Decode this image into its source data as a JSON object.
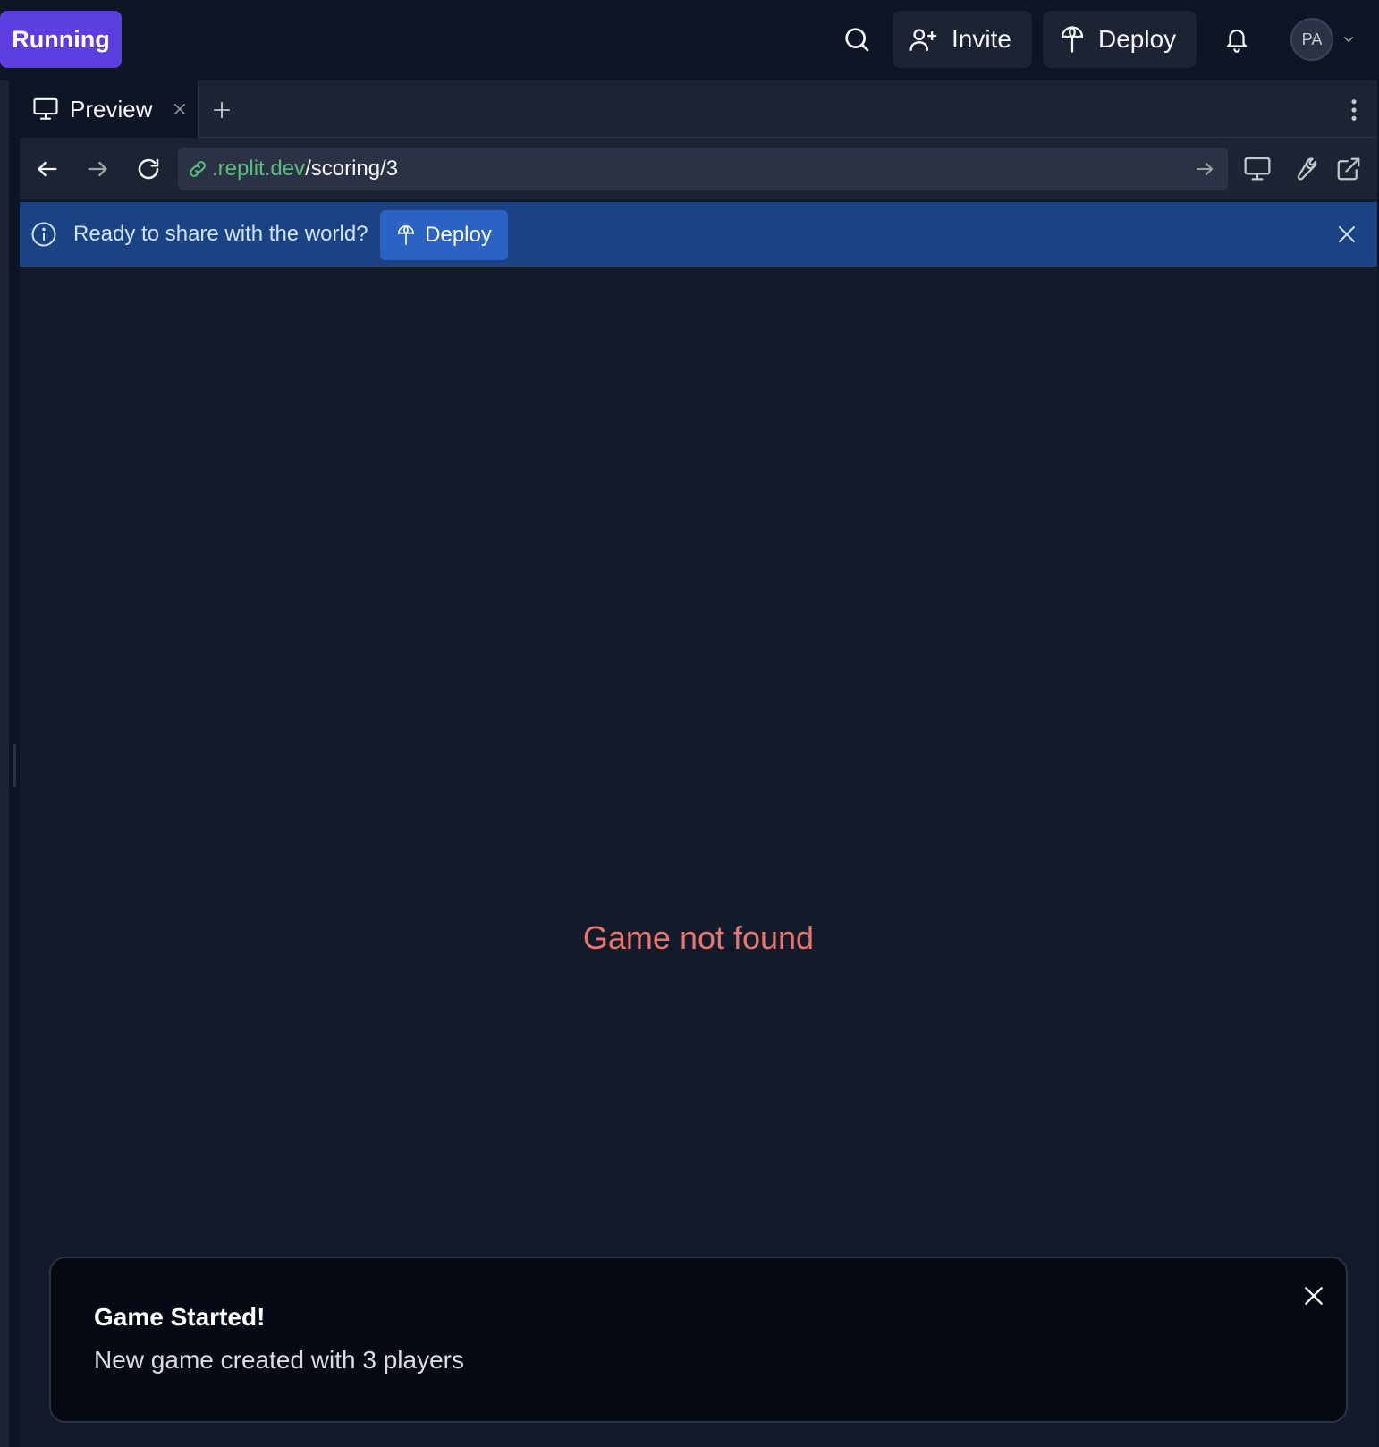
{
  "topbar": {
    "run_label": "Running",
    "invite_label": "Invite",
    "deploy_label": "Deploy",
    "avatar_initials": "PA",
    "run_color": "#5b3ee0"
  },
  "tabs": [
    {
      "label": "Preview",
      "icon": "monitor-icon",
      "active": true
    }
  ],
  "browser": {
    "url_host": ".replit.dev",
    "url_path": "/scoring/3"
  },
  "banner": {
    "message": "Ready to share with the world?",
    "deploy_label": "Deploy",
    "color": "#1b4282"
  },
  "main": {
    "error_text": "Game not found",
    "error_color": "#e8766e"
  },
  "toast": {
    "title": "Game Started!",
    "description": "New game created with 3 players"
  }
}
